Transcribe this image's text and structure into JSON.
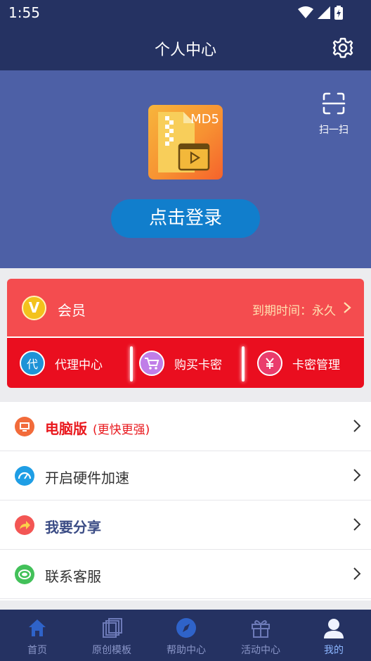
{
  "status_bar": {
    "time": "1:55"
  },
  "header": {
    "title": "个人中心"
  },
  "hero": {
    "scan_label": "扫一扫",
    "logo_text": "MD5",
    "login_label": "点击登录"
  },
  "vip": {
    "badge": "V",
    "label": "会员",
    "expire": "到期时间：永久",
    "items": [
      {
        "icon": "agent-icon",
        "glyph": "代",
        "label": "代理中心"
      },
      {
        "icon": "cart-icon",
        "glyph": "",
        "label": "购买卡密"
      },
      {
        "icon": "card-key-icon",
        "glyph": "",
        "label": "卡密管理"
      }
    ]
  },
  "menu": [
    {
      "label": "电脑版",
      "sub": "(更快更强)",
      "icon": "desktop-icon",
      "color": "#f26b3a"
    },
    {
      "label": "开启硬件加速",
      "sub": "",
      "icon": "speedometer-icon",
      "color": "#1f9ee5"
    },
    {
      "label": "我要分享",
      "sub": "",
      "icon": "share-icon",
      "color": "#f35654"
    },
    {
      "label": "联系客服",
      "sub": "",
      "icon": "headset-icon",
      "color": "#43c15a"
    }
  ],
  "tabs": [
    {
      "label": "首页",
      "icon": "home-icon"
    },
    {
      "label": "原创模板",
      "icon": "templates-icon"
    },
    {
      "label": "帮助中心",
      "icon": "compass-icon"
    },
    {
      "label": "活动中心",
      "icon": "gift-icon"
    },
    {
      "label": "我的",
      "icon": "profile-icon",
      "active": true
    }
  ],
  "colors": {
    "header": "#253262",
    "hero": "#4d60a6",
    "login_button": "#117ecc",
    "vip_top": "#f44c4f",
    "vip_bottom": "#ea0e1f",
    "tab_active": "#8cb6ff"
  }
}
